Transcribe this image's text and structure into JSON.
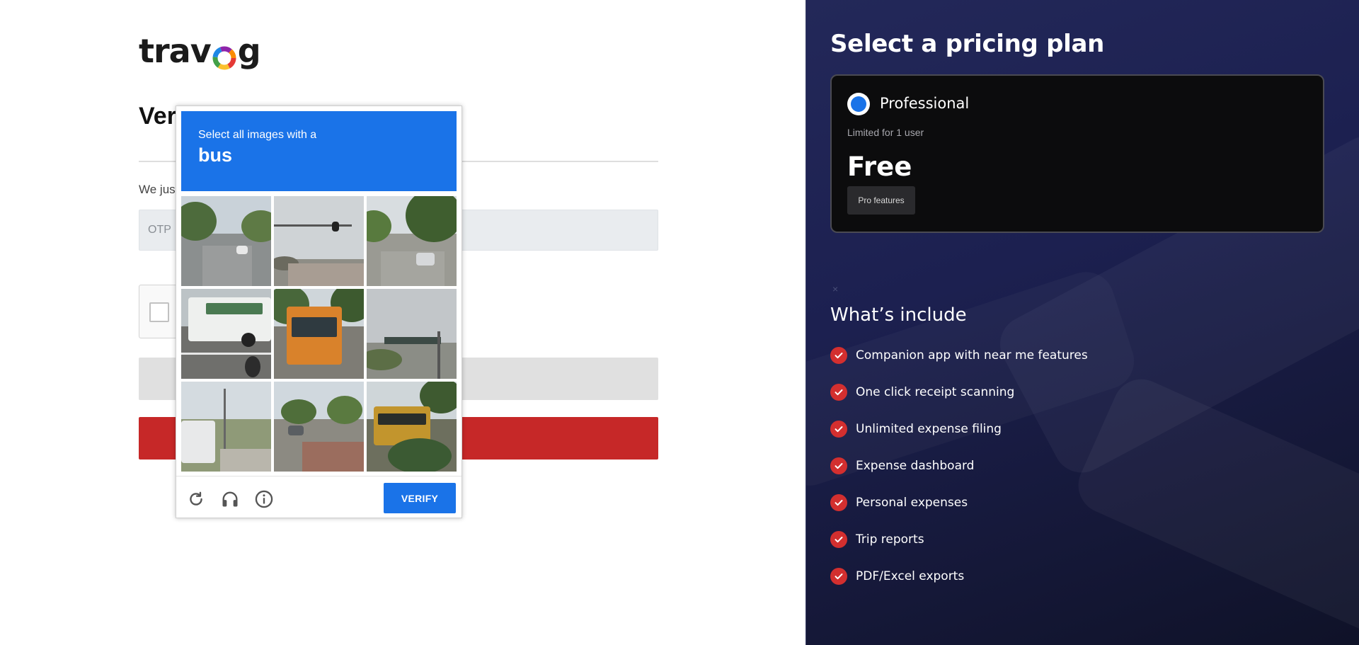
{
  "brand": {
    "logo_prefix": "trav",
    "logo_suffix": "g"
  },
  "verify_page": {
    "title": "Ver",
    "instruction": "We jus",
    "otp_placeholder": "OTP"
  },
  "captcha": {
    "prompt_line1": "Select all images with a",
    "prompt_target": "bus",
    "verify_label": "VERIFY",
    "footer_icons": [
      "reload-icon",
      "headphones-icon",
      "info-icon"
    ],
    "accent_color": "#1a73e8"
  },
  "pricing": {
    "title": "Select a pricing plan",
    "plan": {
      "name": "Professional",
      "limit": "Limited for 1 user",
      "price": "Free",
      "features_button": "Pro features"
    },
    "close_mark": "×",
    "includes_title": "What’s include",
    "features": [
      "Companion app with near me features",
      "One click receipt scanning",
      "Unlimited expense filing",
      "Expense dashboard",
      "Personal expenses",
      "Trip reports",
      "PDF/Excel exports"
    ],
    "check_color": "#d32f2f"
  },
  "colors": {
    "primary_red": "#c62828",
    "right_panel_bg": "#1c2050",
    "card_bg": "#0c0c0d"
  }
}
